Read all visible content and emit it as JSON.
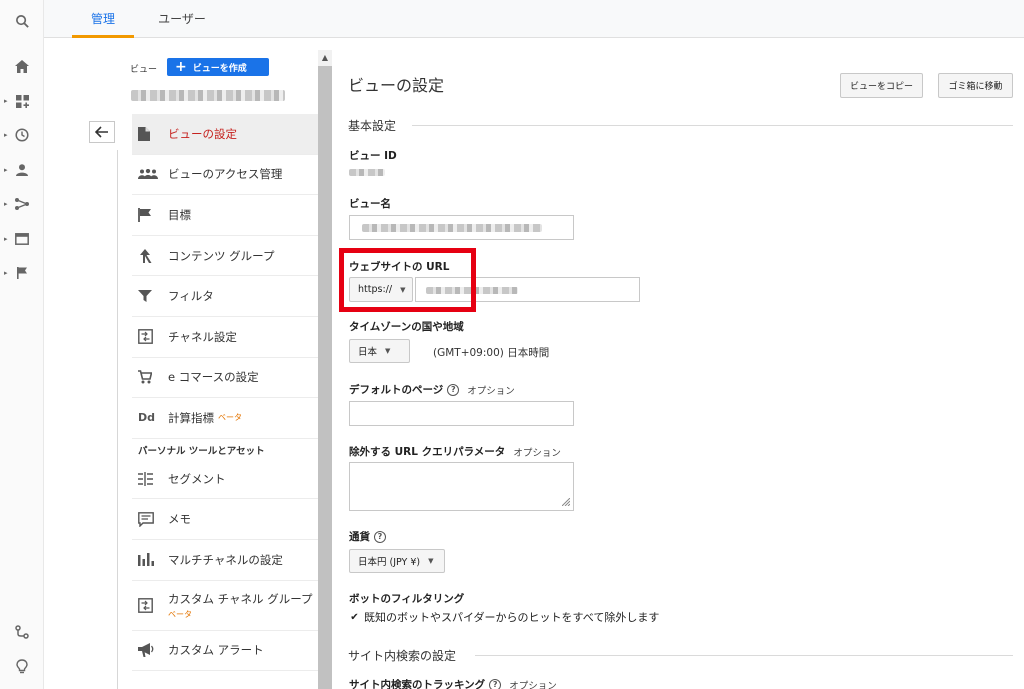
{
  "rail": {
    "icons": [
      "search-icon",
      "home-icon",
      "dashboard-icon",
      "clock-icon",
      "person-icon",
      "acquisition-icon",
      "behavior-icon",
      "flag-icon",
      "connector-icon",
      "bulb-icon"
    ]
  },
  "topbar": {
    "tabs": [
      {
        "label": "管理",
        "active": true
      },
      {
        "label": "ユーザー",
        "active": false
      }
    ]
  },
  "view": {
    "label": "ビュー",
    "create_button": "ビューを作成"
  },
  "nav": {
    "items": [
      {
        "label": "ビューの設定",
        "icon": "document-icon",
        "active": true
      },
      {
        "label": "ビューのアクセス管理",
        "icon": "people-icon"
      },
      {
        "label": "目標",
        "icon": "flag-icon"
      },
      {
        "label": "コンテンツ グループ",
        "icon": "content-group-icon"
      },
      {
        "label": "フィルタ",
        "icon": "filter-icon"
      },
      {
        "label": "チャネル設定",
        "icon": "channel-icon"
      },
      {
        "label": "e コマースの設定",
        "icon": "cart-icon"
      },
      {
        "label": "計算指標",
        "icon": "dd-icon",
        "beta": "ベータ"
      }
    ],
    "section_title": "パーソナル ツールとアセット",
    "tool_items": [
      {
        "label": "セグメント",
        "icon": "segment-icon"
      },
      {
        "label": "メモ",
        "icon": "memo-icon"
      },
      {
        "label": "マルチチャネルの設定",
        "icon": "bar-chart-icon"
      },
      {
        "label": "カスタム チャネル グループ",
        "icon": "channel-icon",
        "beta": "ベータ"
      },
      {
        "label": "カスタム アラート",
        "icon": "megaphone-icon"
      }
    ]
  },
  "main": {
    "title": "ビューの設定",
    "copy_button": "ビューをコピー",
    "trash_button": "ゴミ箱に移動",
    "basic_section": "基本設定",
    "view_id_label": "ビュー ID",
    "view_name_label": "ビュー名",
    "website_url_label": "ウェブサイトの URL",
    "protocol": "https://",
    "timezone_label": "タイムゾーンの国や地域",
    "country": "日本",
    "timezone": "(GMT+09:00) 日本時間",
    "default_page_label": "デフォルトのページ",
    "default_page_option": "オプション",
    "exclude_params_label": "除外する URL クエリパラメータ",
    "exclude_params_option": "オプション",
    "currency_label": "通貨",
    "currency": "日本円 (JPY ¥)",
    "bot_label": "ボットのフィルタリング",
    "bot_checkbox_text": "既知のボットやスパイダーからのヒットをすべて除外します",
    "bot_checked": true,
    "site_search_section": "サイト内検索の設定",
    "site_search_tracking_label": "サイト内検索のトラッキング",
    "site_search_option": "オプション"
  }
}
